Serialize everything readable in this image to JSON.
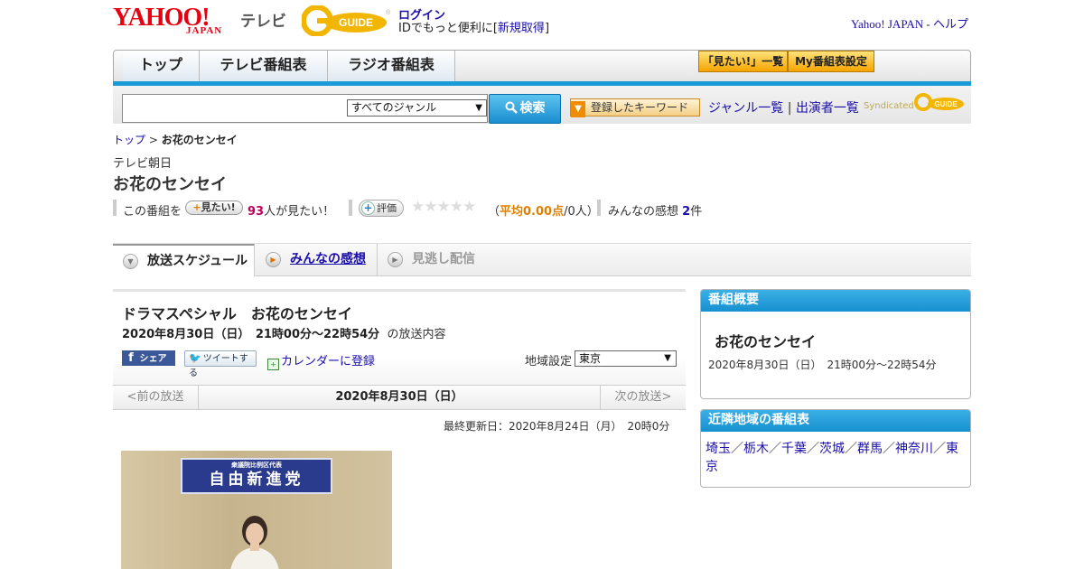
{
  "header": {
    "logo_main": "YAHOO!",
    "logo_sub": "JAPAN",
    "tv_label": "テレビ",
    "gguide_logo": "G GUIDE",
    "login": "ログイン",
    "id_prefix": "IDでもっと便利に[",
    "signup": "新規取得",
    "id_suffix": "]",
    "yahoo_japan": "Yahoo! JAPAN",
    "sep": "-",
    "help": "ヘルプ"
  },
  "nav": {
    "tabs": [
      "トップ",
      "テレビ番組表",
      "ラジオ番組表"
    ],
    "watchlist_btn": "「見たい!」一覧",
    "my_schedule_btn": "My番組表設定"
  },
  "search": {
    "placeholder": "",
    "genre_selected": "すべてのジャンル",
    "button": "検索",
    "keyword_btn": "登録したキーワード",
    "genre_list": "ジャンル一覧",
    "link_sep": "|",
    "performer_list": "出演者一覧",
    "syndicated": "Syndicated"
  },
  "breadcrumb": {
    "top": "トップ",
    "sep": ">",
    "current": "お花のセンセイ"
  },
  "program": {
    "channel": "テレビ朝日",
    "title": "お花のセンセイ",
    "watch_prefix": "この番組を",
    "watch_btn": "見たい!",
    "watch_count": "93",
    "watch_suffix": "人が見たい！",
    "rate_btn": "評価",
    "stars": "★★★★★",
    "avg_open": "（",
    "avg_label": "平均0.00点",
    "avg_rest": "/0人）",
    "impressions_label": "みんなの感想",
    "impressions_count": "2",
    "impressions_unit": "件"
  },
  "tabs": {
    "schedule": "放送スケジュール",
    "reviews": "みんなの感想",
    "vod": "見逃し配信"
  },
  "broadcast": {
    "title": "ドラマスペシャル　お花のセンセイ",
    "datetime": "2020年8月30日（日）　21時00分～22時54分",
    "suffix": "の放送内容",
    "share": "シェア",
    "tweet": "ツイートする",
    "calendar": "カレンダーに登録",
    "region_label": "地域設定",
    "region_selected": "東京",
    "prev": "<前の放送",
    "date": "2020年8月30日（日）",
    "next": "次の放送>",
    "updated": "最終更新日：2020年8月24日（月）　20時0分"
  },
  "photo": {
    "banner_small": "衆議院比例区代表",
    "banner_big": "自由新進党"
  },
  "sidebar": {
    "overview_header": "番組概要",
    "overview_title": "お花のセンセイ",
    "overview_time": "2020年8月30日（日）　21時00分～22時54分",
    "neighbor_header": "近隣地域の番組表",
    "neighbor_regions": [
      "埼玉",
      "栃木",
      "千葉",
      "茨城",
      "群馬",
      "神奈川",
      "東京"
    ],
    "neighbor_sep": "／"
  },
  "colors": {
    "accent_blue": "#1a9ad6",
    "brand_red": "#e60012",
    "watch_count": "#c0005a",
    "avg": "#e08000"
  }
}
